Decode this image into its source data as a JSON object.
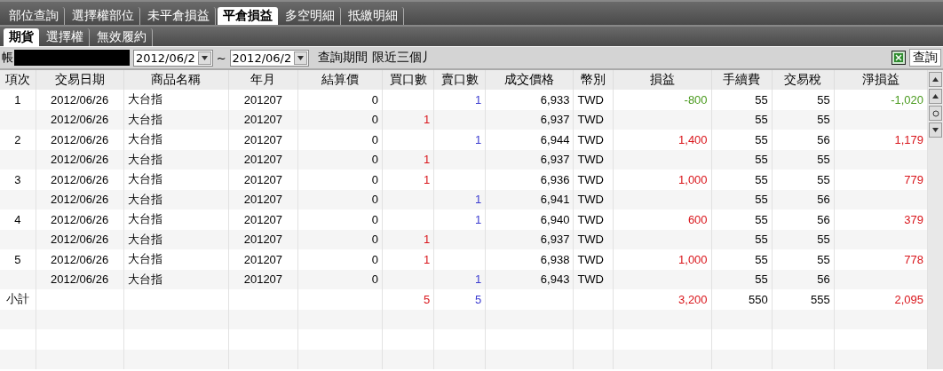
{
  "main_tabs": [
    {
      "label": "部位查詢",
      "selected": false
    },
    {
      "label": "選擇權部位",
      "selected": false
    },
    {
      "label": "未平倉損益",
      "selected": false
    },
    {
      "label": "平倉損益",
      "selected": true
    },
    {
      "label": "多空明細",
      "selected": false
    },
    {
      "label": "抵繳明細",
      "selected": false
    }
  ],
  "sub_tabs": [
    {
      "label": "期貨",
      "selected": true
    },
    {
      "label": "選擇權",
      "selected": false
    },
    {
      "label": "無效履約",
      "selected": false
    }
  ],
  "toolbar": {
    "account_label": "帳",
    "date_from": "2012/06/2",
    "separator": "~",
    "date_to": "2012/06/2",
    "period_note": "查詢期間 限近三個丿",
    "query_button": "查詢"
  },
  "table": {
    "columns": [
      "項次",
      "交易日期",
      "商品名稱",
      "年月",
      "結算價",
      "買口數",
      "賣口數",
      "成交價格",
      "幣別",
      "損益",
      "手續費",
      "交易稅",
      "淨損益"
    ],
    "rows": [
      {
        "cells": [
          "1",
          "2012/06/26",
          "大台指",
          "201207",
          "0",
          "",
          "1",
          "6,933",
          "TWD",
          "-800",
          "55",
          "55",
          "-1,020"
        ],
        "color": "#4a9a1e"
      },
      {
        "cells": [
          "",
          "2012/06/26",
          "大台指",
          "201207",
          "0",
          "1",
          "",
          "6,937",
          "TWD",
          "",
          "55",
          "55",
          ""
        ]
      },
      {
        "cells": [
          "2",
          "2012/06/26",
          "大台指",
          "201207",
          "0",
          "",
          "1",
          "6,944",
          "TWD",
          "1,400",
          "55",
          "56",
          "1,179"
        ],
        "color": "#d9151b"
      },
      {
        "cells": [
          "",
          "2012/06/26",
          "大台指",
          "201207",
          "0",
          "1",
          "",
          "6,937",
          "TWD",
          "",
          "55",
          "55",
          ""
        ]
      },
      {
        "cells": [
          "3",
          "2012/06/26",
          "大台指",
          "201207",
          "0",
          "1",
          "",
          "6,936",
          "TWD",
          "1,000",
          "55",
          "55",
          "779"
        ],
        "color": "#d9151b"
      },
      {
        "cells": [
          "",
          "2012/06/26",
          "大台指",
          "201207",
          "0",
          "",
          "1",
          "6,941",
          "TWD",
          "",
          "55",
          "56",
          ""
        ]
      },
      {
        "cells": [
          "4",
          "2012/06/26",
          "大台指",
          "201207",
          "0",
          "",
          "1",
          "6,940",
          "TWD",
          "600",
          "55",
          "56",
          "379"
        ],
        "color": "#d9151b"
      },
      {
        "cells": [
          "",
          "2012/06/26",
          "大台指",
          "201207",
          "0",
          "1",
          "",
          "6,937",
          "TWD",
          "",
          "55",
          "55",
          ""
        ]
      },
      {
        "cells": [
          "5",
          "2012/06/26",
          "大台指",
          "201207",
          "0",
          "1",
          "",
          "6,938",
          "TWD",
          "1,000",
          "55",
          "55",
          "778"
        ],
        "color": "#d9151b"
      },
      {
        "cells": [
          "",
          "2012/06/26",
          "大台指",
          "201207",
          "0",
          "",
          "1",
          "6,943",
          "TWD",
          "",
          "55",
          "56",
          ""
        ]
      },
      {
        "cells": [
          "小計",
          "",
          "",
          "",
          "",
          "5",
          "5",
          "",
          "",
          "3,200",
          "550",
          "555",
          "2,095"
        ],
        "color": "#d9151b"
      }
    ]
  }
}
